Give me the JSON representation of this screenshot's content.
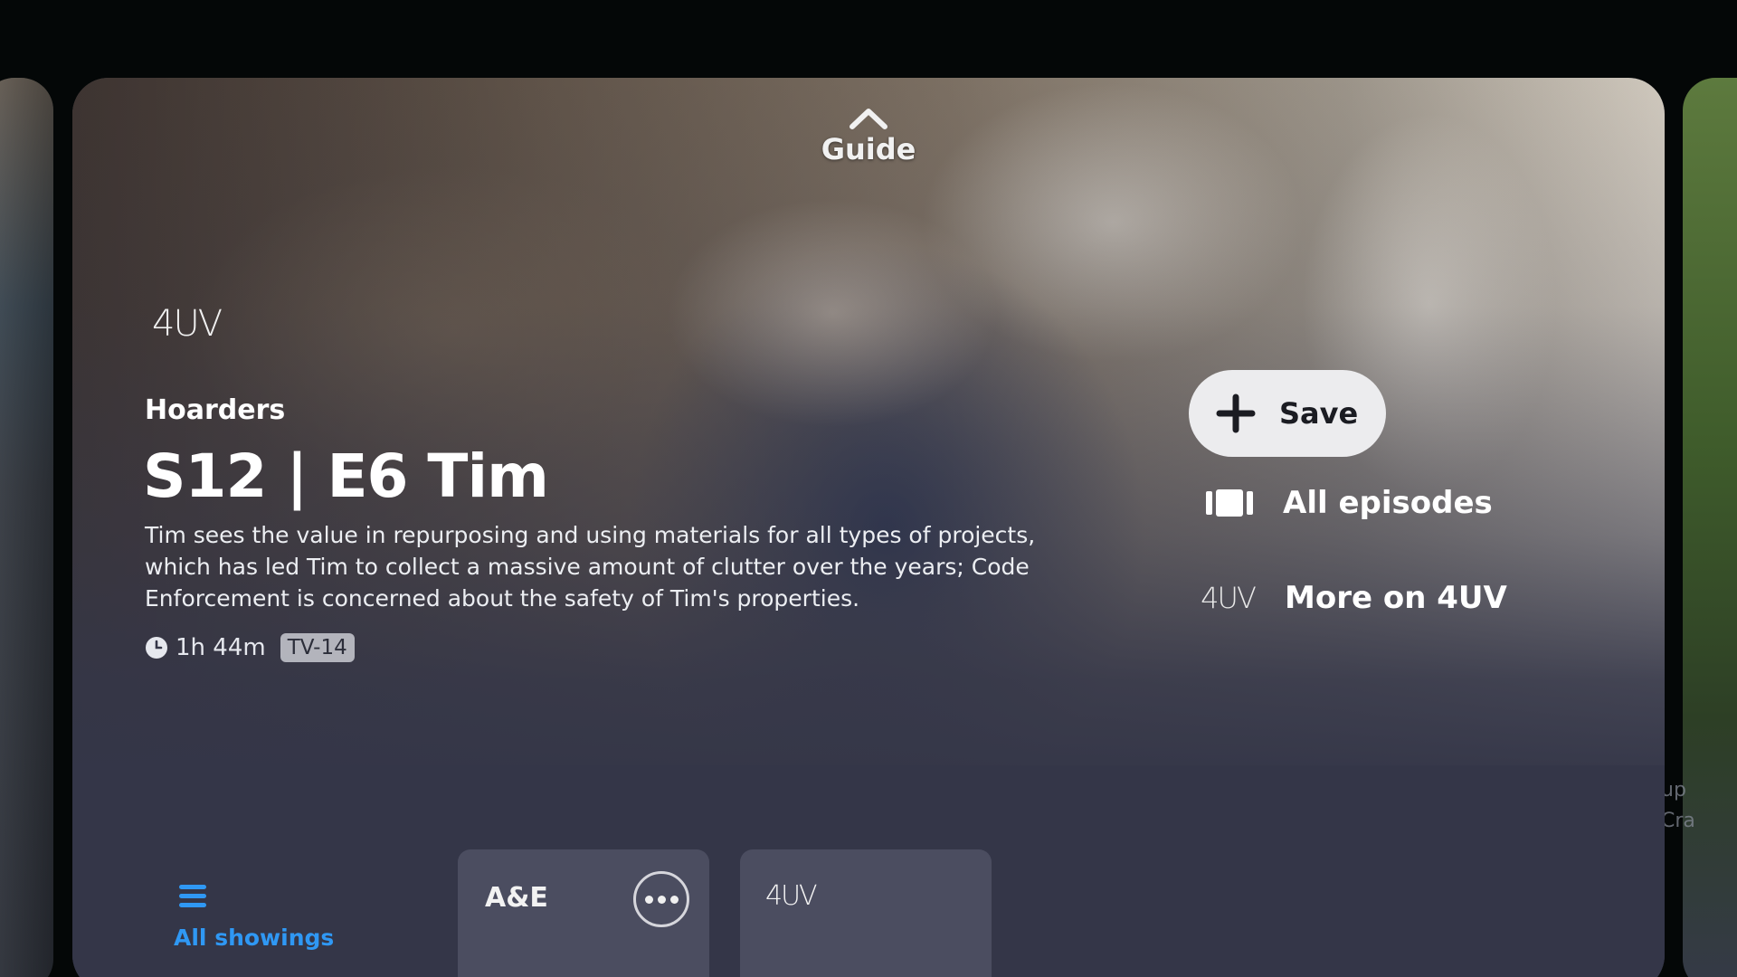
{
  "guide": {
    "label": "Guide"
  },
  "program": {
    "network_logo": "4UV",
    "show_title": "Hoarders",
    "episode_title": "S12 | E6 Tim",
    "description": "Tim sees the value in repurposing and using materials for all types of projects, which has led Tim to collect a massive amount of clutter over the years; Code Enforcement is concerned about the safety of Tim's properties.",
    "duration": "1h 44m",
    "rating": "TV-14"
  },
  "actions": {
    "save_label": "Save",
    "all_episodes_label": "All episodes",
    "more_on_label": "More on 4UV",
    "more_on_logo": "4UV"
  },
  "bottom": {
    "all_showings_label": "All showings",
    "tiles": [
      {
        "logo": "A&E"
      },
      {
        "logo": "4UV"
      }
    ]
  },
  "peek_right": {
    "text": "up\nCra"
  },
  "colors": {
    "accent": "#2f98f4",
    "card_bg": "#343648",
    "tile_bg": "#4b4d60",
    "save_bg": "#ececee"
  },
  "icons": [
    "chevron-up-icon",
    "clock-icon",
    "plus-icon",
    "episodes-icon",
    "list-icon",
    "more-dots-icon"
  ]
}
